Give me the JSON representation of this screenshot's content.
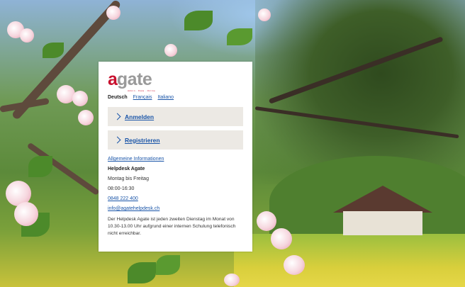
{
  "brand": {
    "logo_a": "a",
    "logo_rest": "gate",
    "tagline": "Admin · Data · Online"
  },
  "languages": {
    "active": "Deutsch",
    "others": [
      "Français",
      "Italiano"
    ]
  },
  "actions": {
    "login_label": "Anmelden",
    "register_label": "Registrieren"
  },
  "info": {
    "general_link": "Allgemeine Informationen",
    "helpdesk_title": "Helpdesk Agate",
    "days": "Montag bis Freitag",
    "hours": "08:00-16:30",
    "phone": "0848 222 400",
    "email": "info@agatehelpdesk.ch",
    "notice": "Der Helpdesk Agate ist jeden zweiten Dienstag im Monat von 10.30-13.00 Uhr aufgrund einer internen Schulung telefonisch nicht erreichbar."
  },
  "colors": {
    "brand_red": "#c8102e",
    "logo_grey": "#9a9a9a",
    "link_blue": "#1a55a8",
    "panel_bg": "#ece9e4"
  }
}
